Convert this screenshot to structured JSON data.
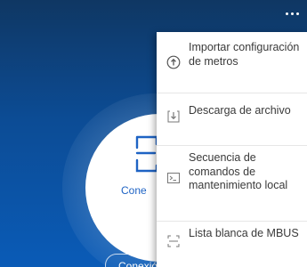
{
  "main": {
    "circle_label": "Cone",
    "connect_button_label": "Conexión"
  },
  "menu": {
    "items": [
      {
        "label": "Importar configuración de metros",
        "icon": "upload-circle-icon"
      },
      {
        "label": "Descarga de archivo",
        "icon": "download-icon"
      },
      {
        "label": "Secuencia de comandos de mantenimiento local",
        "icon": "terminal-icon"
      },
      {
        "label": "Lista blanca de MBUS",
        "icon": "scan-frame-icon"
      }
    ]
  },
  "colors": {
    "background_top": "#0f3763",
    "background_bottom": "#0a5bb7",
    "accent": "#1e63c4",
    "menu_bg": "#ffffff",
    "menu_text": "#3a3a3a"
  }
}
